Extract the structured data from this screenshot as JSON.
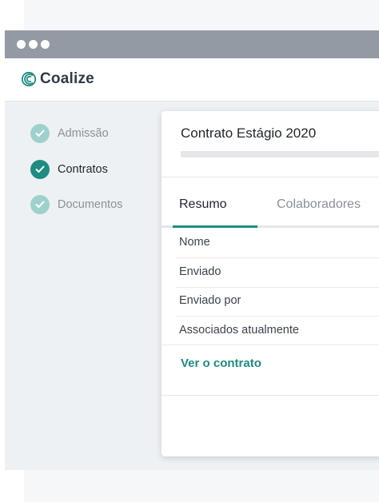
{
  "app": {
    "name": "Coalize",
    "accent": "#1f8c82",
    "accent_light": "#9fd1cc"
  },
  "steps": [
    {
      "label": "Admissão",
      "state": "done"
    },
    {
      "label": "Contratos",
      "state": "active"
    },
    {
      "label": "Documentos",
      "state": "done"
    }
  ],
  "card": {
    "title": "Contrato Estágio 2020",
    "tabs": [
      {
        "label": "Resumo",
        "active": true
      },
      {
        "label": "Colaboradores",
        "active": false
      }
    ],
    "fields": [
      "Nome",
      "Enviado",
      "Enviado por",
      "Associados atualmente"
    ],
    "link_label": "Ver o contrato"
  }
}
